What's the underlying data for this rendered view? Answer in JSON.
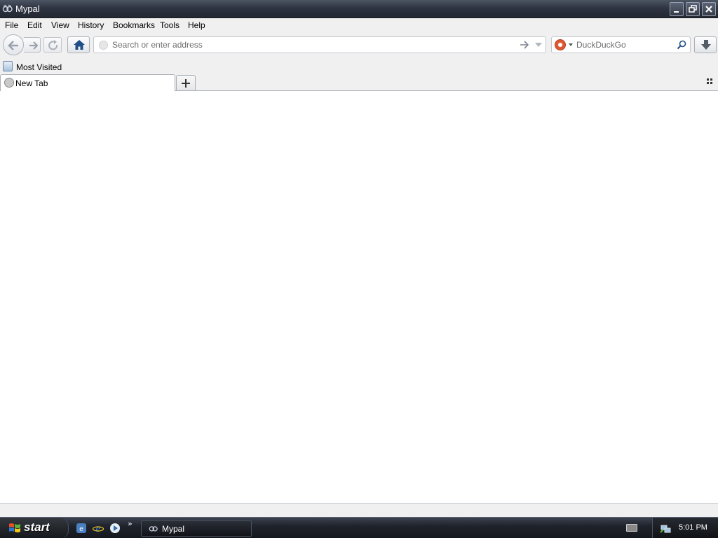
{
  "window": {
    "title": "Mypal"
  },
  "menu": {
    "items": [
      {
        "label": "File"
      },
      {
        "label": "Edit"
      },
      {
        "label": "View"
      },
      {
        "label": "History"
      },
      {
        "label": "Bookmarks"
      },
      {
        "label": "Tools"
      },
      {
        "label": "Help"
      }
    ]
  },
  "navbar": {
    "url_placeholder": "Search or enter address",
    "url_value": "",
    "search_placeholder": "DuckDuckGo",
    "search_engine_icon": "duckduckgo-icon"
  },
  "bookmarks": {
    "items": [
      {
        "label": "Most Visited",
        "icon": "most-visited-icon"
      }
    ]
  },
  "tabs": {
    "items": [
      {
        "label": "New Tab"
      }
    ]
  },
  "taskbar": {
    "start_label": "start",
    "task_label": "Mypal",
    "clock": "5:01 PM"
  },
  "colors": {
    "toolbar_bg": "#f0f0f0",
    "titlebar_bg": "#2e3441",
    "taskbar_bg": "#1f232b",
    "home_icon": "#1f4f86"
  }
}
